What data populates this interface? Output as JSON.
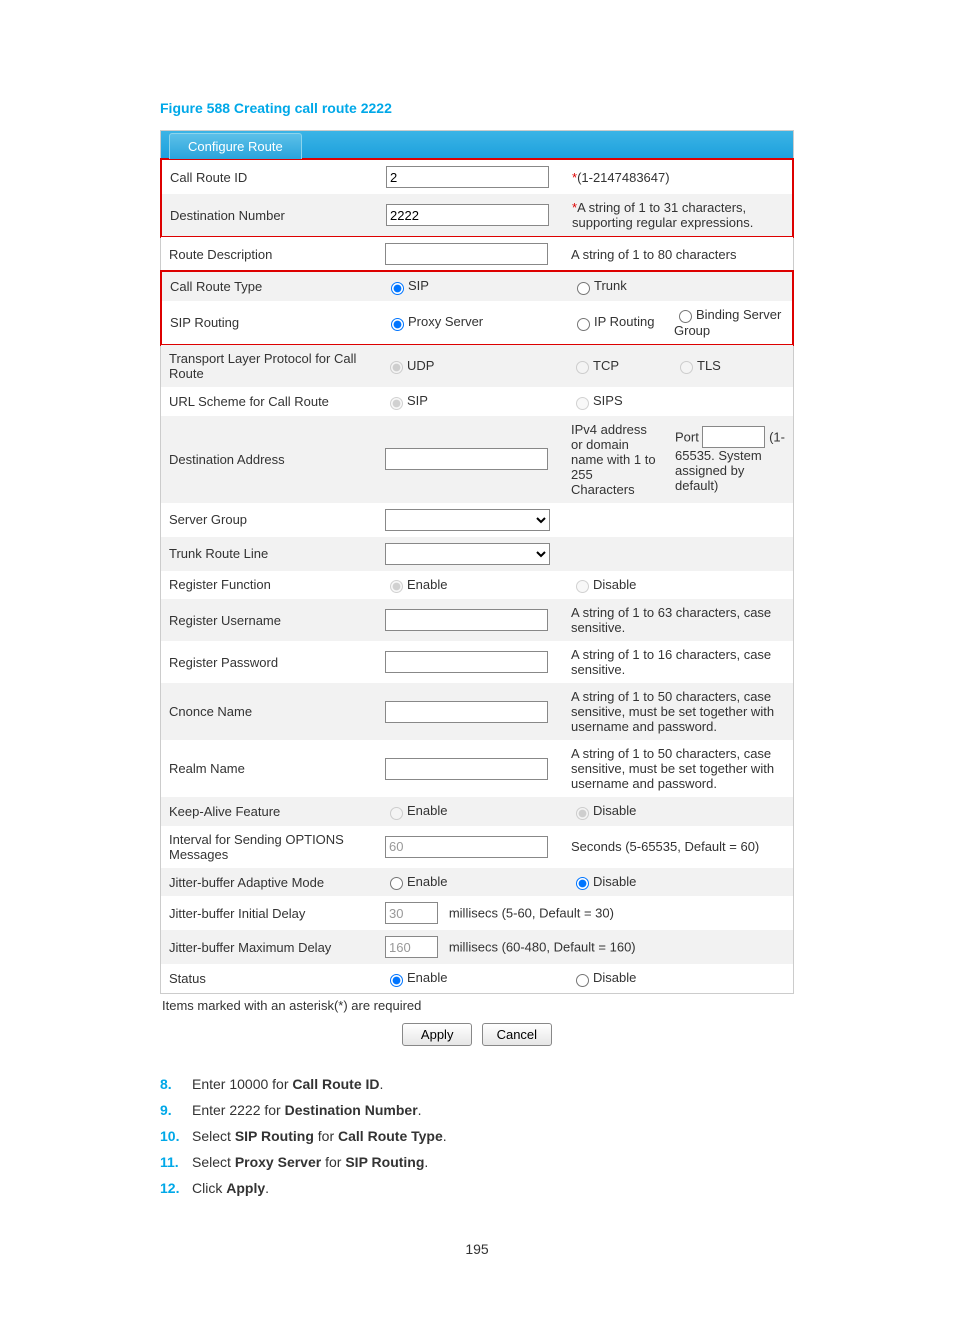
{
  "figure_title": "Figure 588 Creating call route 2222",
  "tab": "Configure Route",
  "rows": {
    "call_route_id": {
      "label": "Call Route ID",
      "value": "2",
      "hint_star": "*",
      "hint": "(1-2147483647)"
    },
    "dest_number": {
      "label": "Destination Number",
      "value": "2222",
      "hint_star": "*",
      "hint": "A string of 1 to 31 characters, supporting regular expressions."
    },
    "route_desc": {
      "label": "Route Description",
      "value": "",
      "hint": "A string of 1 to 80 characters"
    },
    "call_route_type": {
      "label": "Call Route Type",
      "opt1": "SIP",
      "opt2": "Trunk"
    },
    "sip_routing": {
      "label": "SIP Routing",
      "opt1": "Proxy Server",
      "opt2": "IP Routing",
      "opt3": "Binding Server Group"
    },
    "transport": {
      "label": "Transport Layer Protocol for Call Route",
      "opt1": "UDP",
      "opt2": "TCP",
      "opt3": "TLS"
    },
    "url_scheme": {
      "label": "URL Scheme for Call Route",
      "opt1": "SIP",
      "opt2": "SIPS"
    },
    "dest_addr": {
      "label": "Destination Address",
      "value": "",
      "hint": "IPv4 address or domain name with 1 to 255 Characters",
      "port_label": "Port",
      "port_value": "",
      "port_hint": "(1-65535. System assigned by default)"
    },
    "server_group": {
      "label": "Server Group"
    },
    "trunk_route_line": {
      "label": "Trunk Route Line"
    },
    "register_func": {
      "label": "Register Function",
      "opt1": "Enable",
      "opt2": "Disable"
    },
    "reg_username": {
      "label": "Register Username",
      "value": "",
      "hint": "A string of 1 to 63 characters, case sensitive."
    },
    "reg_password": {
      "label": "Register Password",
      "value": "",
      "hint": "A string of 1 to 16 characters, case sensitive."
    },
    "cnonce": {
      "label": "Cnonce Name",
      "value": "",
      "hint": "A string of 1 to 50 characters, case sensitive, must be set together with username and password."
    },
    "realm": {
      "label": "Realm Name",
      "value": "",
      "hint": "A string of 1 to 50 characters, case sensitive, must be set together with username and password."
    },
    "keep_alive": {
      "label": "Keep-Alive Feature",
      "opt1": "Enable",
      "opt2": "Disable"
    },
    "options_interval": {
      "label": "Interval for Sending OPTIONS Messages",
      "value": "60",
      "hint": "Seconds (5-65535, Default = 60)"
    },
    "jbuf_adaptive": {
      "label": "Jitter-buffer Adaptive Mode",
      "opt1": "Enable",
      "opt2": "Disable"
    },
    "jbuf_initial": {
      "label": "Jitter-buffer Initial Delay",
      "value": "30",
      "hint": "millisecs (5-60, Default = 30)"
    },
    "jbuf_max": {
      "label": "Jitter-buffer Maximum Delay",
      "value": "160",
      "hint": "millisecs (60-480, Default = 160)"
    },
    "status": {
      "label": "Status",
      "opt1": "Enable",
      "opt2": "Disable"
    }
  },
  "footnote": "Items marked with an asterisk(*) are required",
  "buttons": {
    "apply": "Apply",
    "cancel": "Cancel"
  },
  "steps": [
    {
      "n": "8.",
      "pre": "Enter 10000 for ",
      "bold": "Call Route ID",
      "post": "."
    },
    {
      "n": "9.",
      "pre": "Enter 2222 for ",
      "bold": "Destination Number",
      "post": "."
    },
    {
      "n": "10.",
      "pre": "Select ",
      "bold": "SIP Routing",
      "mid": " for ",
      "bold2": "Call Route Type",
      "post": "."
    },
    {
      "n": "11.",
      "pre": "Select ",
      "bold": "Proxy Server",
      "mid": " for ",
      "bold2": "SIP Routing",
      "post": "."
    },
    {
      "n": "12.",
      "pre": "Click ",
      "bold": "Apply",
      "post": "."
    }
  ],
  "page_number": "195"
}
